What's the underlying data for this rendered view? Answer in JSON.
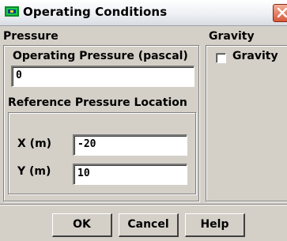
{
  "window": {
    "title": "Operating Conditions"
  },
  "pressure": {
    "group_label": "Pressure",
    "operating_pressure_label": "Operating Pressure (pascal)",
    "operating_pressure_value": "0",
    "reference_location": {
      "group_label": "Reference Pressure Location",
      "x_label": "X (m)",
      "x_value": "-20",
      "y_label": "Y (m)",
      "y_value": "10"
    }
  },
  "gravity": {
    "group_label": "Gravity",
    "checkbox_label": "Gravity",
    "checked": false
  },
  "buttons": {
    "ok": "OK",
    "cancel": "Cancel",
    "help": "Help"
  }
}
